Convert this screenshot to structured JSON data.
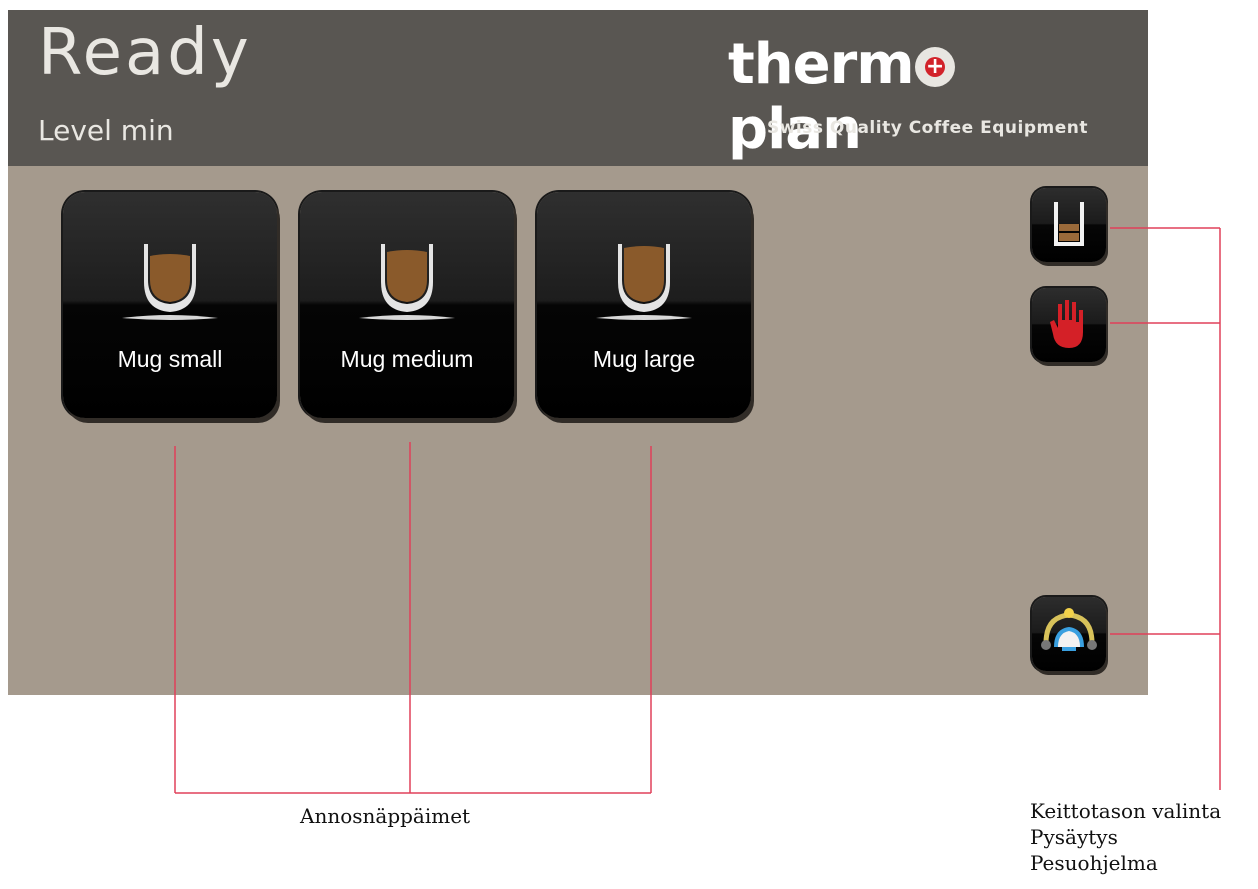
{
  "header": {
    "status": "Ready",
    "level": "Level min"
  },
  "brand": {
    "word_left": "therm",
    "word_right": "plan",
    "tagline": "Swiss Quality Coffee Equipment"
  },
  "buttons": [
    {
      "label": "Mug small",
      "icon": "coffee-mug-icon"
    },
    {
      "label": "Mug medium",
      "icon": "coffee-mug-icon"
    },
    {
      "label": "Mug large",
      "icon": "coffee-mug-icon"
    }
  ],
  "side_buttons": [
    {
      "icon": "cooking-level-icon"
    },
    {
      "icon": "stop-hand-icon"
    },
    {
      "icon": "cleaning-program-icon"
    }
  ],
  "callouts": {
    "portion_buttons": "Annosnäppäimet",
    "right": [
      "Keittotason valinta",
      "Pysäytys",
      "Pesuohjelma"
    ]
  },
  "colors": {
    "screen_bg": "#a59a8d",
    "header_bg": "#595652",
    "callout_line": "#e0405a",
    "stop_red": "#d42027",
    "coffee": "#8a5a2b"
  }
}
